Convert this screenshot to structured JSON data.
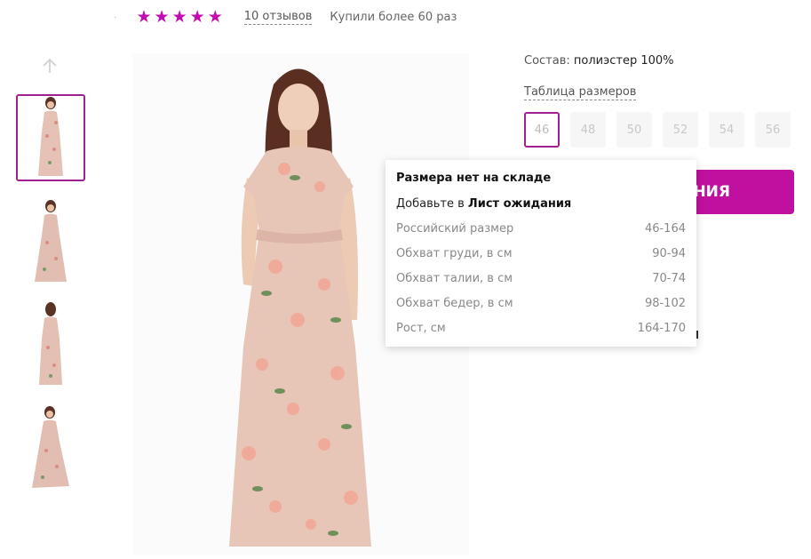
{
  "rating": {
    "stars": 5,
    "star_glyph": "★",
    "reviews_label": "10 отзывов",
    "bought_label": "Купили более 60 раз",
    "accent_color": "#c40cb0"
  },
  "gallery": {
    "up_icon": "arrow-up-icon",
    "thumbnails": 4,
    "active_thumbnail": 1
  },
  "product": {
    "composition_label": "Состав:",
    "composition_value": "полиэстер 100%",
    "size_table_label": "Таблица размеров",
    "sizes": [
      "46",
      "48",
      "50",
      "52",
      "54",
      "56"
    ],
    "selected_size": "46",
    "cta_label_visible": "АНИЯ",
    "cta_color": "#c0109f"
  },
  "tooltip": {
    "title": "Размера нет на складе",
    "wait_prefix": "Добавьте в",
    "wait_link": "Лист ожидания",
    "rows": [
      {
        "label": "Российский размер",
        "value": "46-164"
      },
      {
        "label": "Обхват груди, в см",
        "value": "90-94"
      },
      {
        "label": "Обхват талии, в см",
        "value": "70-74"
      },
      {
        "label": "Обхват бедер, в см",
        "value": "98-102"
      },
      {
        "label": "Рост, см",
        "value": "164-170"
      }
    ]
  }
}
